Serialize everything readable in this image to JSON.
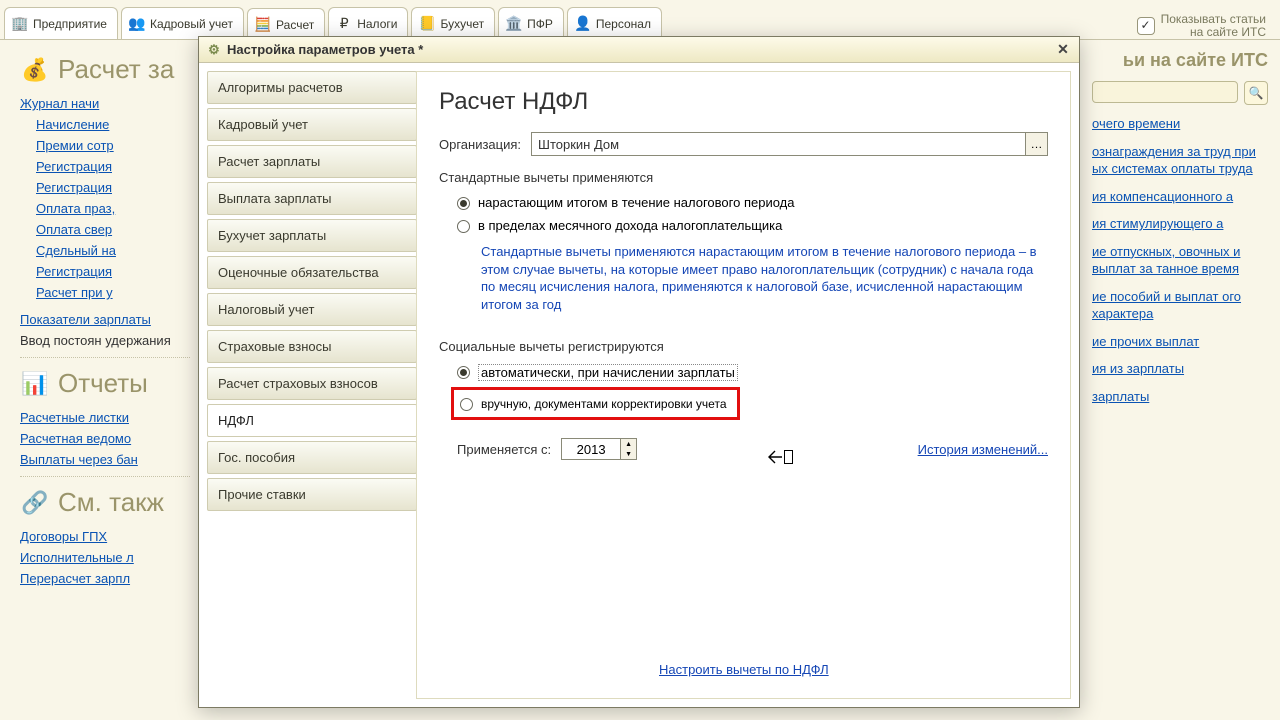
{
  "topTabs": [
    {
      "label": "Предприятие"
    },
    {
      "label": "Кадровый учет"
    },
    {
      "label": "Расчет"
    },
    {
      "label": "Налоги"
    },
    {
      "label": "Бухучет"
    },
    {
      "label": "ПФР"
    },
    {
      "label": "Персонал"
    }
  ],
  "topRight": {
    "line1": "Показывать статьи",
    "line2": "на сайте ИТС"
  },
  "leftPanel": {
    "section1_title": "Расчет за",
    "journalLink": "Журнал начи",
    "treeItems": [
      "Начисление",
      "Премии сотр",
      "Регистрация",
      "Регистрация",
      "Оплата праз,",
      "Оплата свер",
      "Сдельный на",
      "Регистрация",
      "Расчет при у"
    ],
    "pokazateli": "Показатели зарплаты",
    "vvod": "Ввод постоян удержания",
    "section2_title": "Отчеты",
    "reportLinks": [
      "Расчетные листки",
      "Расчетная ведомо",
      "Выплаты через бан"
    ],
    "section3_title": "См. такж",
    "seeAlso": [
      "Договоры ГПХ",
      "Исполнительные л",
      "Перерасчет зарпл"
    ]
  },
  "rightPanel": {
    "title": "ьи на сайте ИТС",
    "links": [
      "очего времени",
      "ознаграждения за труд при ых системах оплаты труда",
      "ия компенсационного а",
      "ия стимулирующего а",
      "ие отпускных, овочных и выплат за танное время",
      "ие пособий и выплат ого характера",
      "ие прочих выплат",
      "ия из зарплаты",
      "зарплаты"
    ]
  },
  "dialog": {
    "title": "Настройка параметров учета *",
    "menu": [
      "Алгоритмы расчетов",
      "Кадровый учет",
      "Расчет зарплаты",
      "Выплата зарплаты",
      "Бухучет зарплаты",
      "Оценочные обязательства",
      "Налоговый учет",
      "Страховые взносы",
      "Расчет страховых взносов",
      "НДФЛ",
      "Гос. пособия",
      "Прочие ставки"
    ],
    "activeMenuIndex": 9,
    "content": {
      "heading": "Расчет НДФЛ",
      "orgLabel": "Организация:",
      "orgValue": "Шторкин Дом",
      "sub1": "Стандартные вычеты применяются",
      "opt1a": "нарастающим итогом в течение налогового периода",
      "opt1b": "в пределах месячного дохода налогоплательщика",
      "info": "Стандартные вычеты применяются нарастающим итогом в течение налогового периода – в этом случае вычеты, на которые имеет право налогоплательщик (сотрудник) с начала года по месяц исчисления налога, применяются к налоговой базе, исчисленной нарастающим итогом за год",
      "sub2": "Социальные вычеты регистрируются",
      "opt2a": "автоматически, при начислении зарплаты",
      "opt2b": "вручную, документами корректировки учета",
      "appliedLabel": "Применяется с:",
      "year": "2013",
      "historyLink": "История изменений...",
      "configLink": "Настроить вычеты по НДФЛ"
    }
  }
}
